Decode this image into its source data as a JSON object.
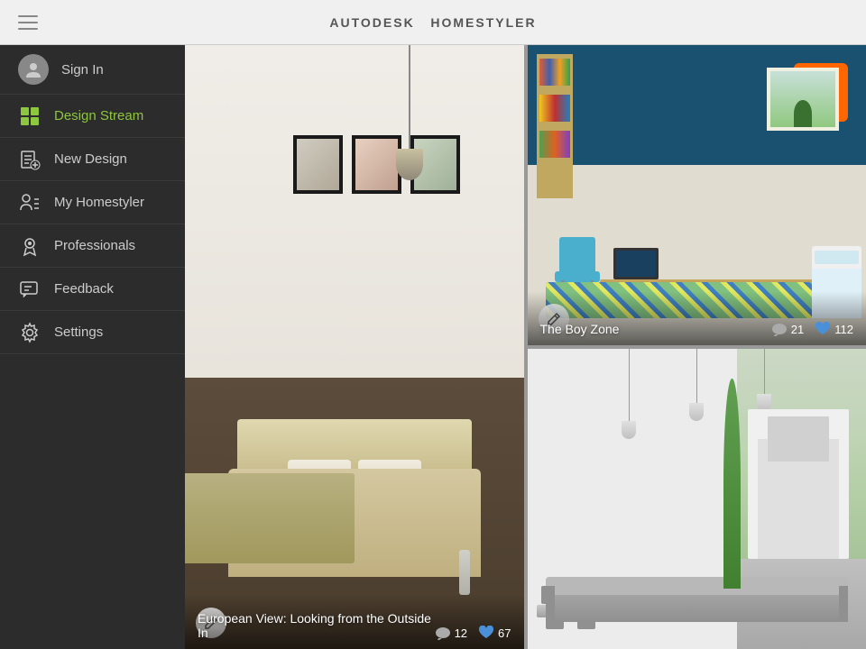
{
  "header": {
    "title_prefix": "AUTODESK",
    "title_suffix": "HOMESTYLER",
    "hamburger_label": "Menu"
  },
  "sidebar": {
    "signin_label": "Sign In",
    "items": [
      {
        "id": "design-stream",
        "label": "Design Stream",
        "active": true
      },
      {
        "id": "new-design",
        "label": "New Design",
        "active": false
      },
      {
        "id": "my-homestyler",
        "label": "My Homestyler",
        "active": false
      },
      {
        "id": "professionals",
        "label": "Professionals",
        "active": false
      },
      {
        "id": "feedback",
        "label": "Feedback",
        "active": false
      },
      {
        "id": "settings",
        "label": "Settings",
        "active": false
      }
    ]
  },
  "designs": {
    "large_card": {
      "title": "European View: Looking from the Outside In",
      "comments": "12",
      "likes": "67"
    },
    "top_right_card": {
      "title": "The Boy Zone",
      "comments": "21",
      "likes": "112"
    },
    "bottom_right_card": {
      "title": "",
      "comments": "",
      "likes": ""
    }
  },
  "icons": {
    "comment": "💬",
    "like": "💙",
    "edit": "✏️",
    "design_stream": "▦",
    "new_design": "📋",
    "my_homestyler": "👤",
    "professionals": "⚙",
    "feedback": "📝",
    "settings": "⚙"
  }
}
